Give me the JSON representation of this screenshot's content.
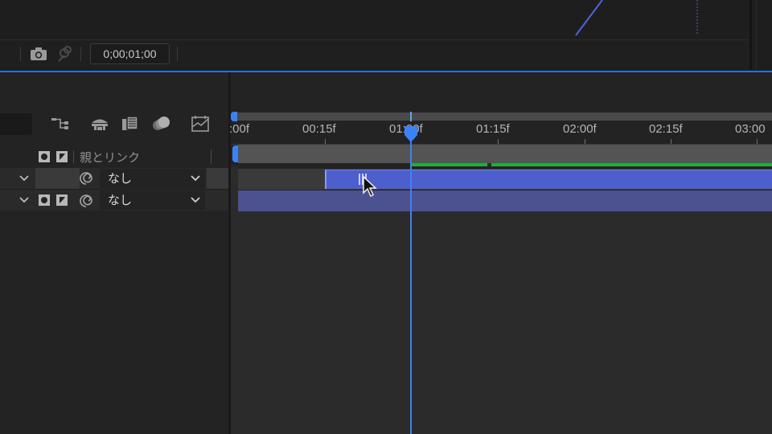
{
  "viewer": {
    "timecode": "0;00;01;00",
    "icons": [
      "camera-snapshot-icon",
      "show-snapshot-icon"
    ]
  },
  "timeline": {
    "header": {
      "parent_link_label": "親とリンク"
    },
    "toolbar_icons": [
      "graph-tree-icon",
      "shy-layers-icon",
      "frame-blending-icon",
      "motion-blur-icon",
      "graph-editor-icon"
    ],
    "ruler": {
      "ticks": [
        ":00f",
        "00:15f",
        "01:00f",
        "01:15f",
        "02:00f",
        "02:15f",
        "03:00"
      ]
    },
    "layers": [
      {
        "parent_value": "なし"
      },
      {
        "parent_value": "なし"
      }
    ],
    "colors": {
      "cti": "#3b82f6",
      "clip_fill": "#4d5fcc",
      "render_bar": "#1fae3a",
      "panel_highlight": "#2d6fd8"
    }
  }
}
